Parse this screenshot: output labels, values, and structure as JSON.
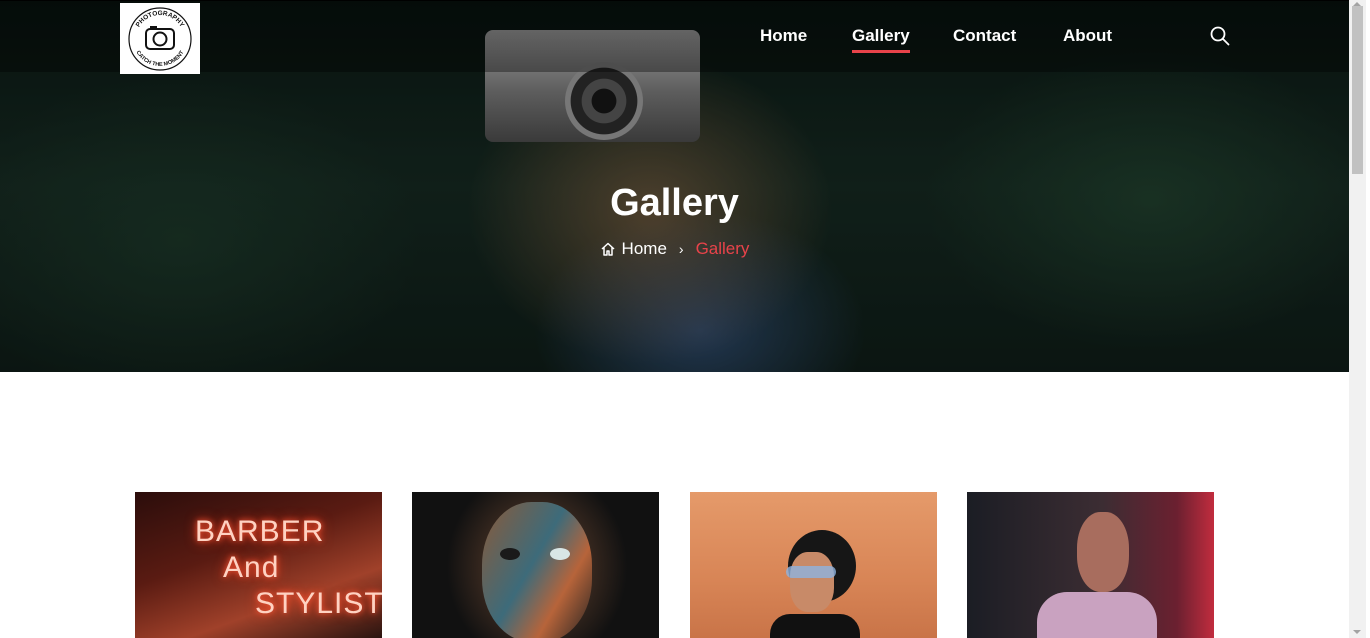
{
  "nav": {
    "logo": {
      "top_text": "PHOTOGRAPHY",
      "bottom_text": "CATCH THE MOMENT"
    },
    "links": [
      {
        "label": "Home",
        "active": false
      },
      {
        "label": "Gallery",
        "active": true
      },
      {
        "label": "Contact",
        "active": false
      },
      {
        "label": "About",
        "active": false
      }
    ],
    "search_icon": "search-icon"
  },
  "hero": {
    "title": "Gallery",
    "breadcrumb": {
      "home_icon": "home-icon",
      "home": "Home",
      "separator": "›",
      "current": "Gallery"
    }
  },
  "gallery": {
    "items": [
      {
        "subject": "barber-neon",
        "neon_text": [
          "BARBER",
          "And",
          "STYLIST"
        ]
      },
      {
        "subject": "painted-face"
      },
      {
        "subject": "hat-sunglasses"
      },
      {
        "subject": "neon-window-man"
      }
    ]
  },
  "colors": {
    "accent": "#e8434a",
    "nav_text": "#ffffff",
    "page_bg": "#ffffff"
  }
}
